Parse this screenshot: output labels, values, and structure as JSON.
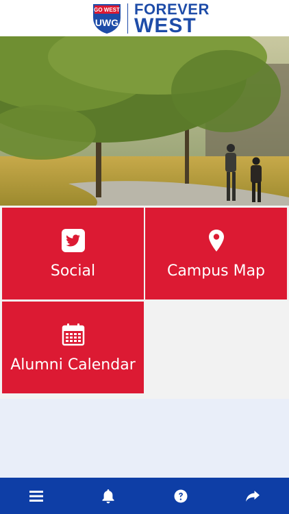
{
  "header": {
    "shield_top": "GO WEST",
    "shield_main": "UWG",
    "wordmark_line1": "FOREVER",
    "wordmark_line2": "WEST"
  },
  "tiles": [
    {
      "label": "Social",
      "icon": "twitter-icon"
    },
    {
      "label": "Campus Map",
      "icon": "map-pin-icon"
    },
    {
      "label": "Alumni Calendar",
      "icon": "calendar-icon"
    }
  ],
  "bottom_nav": [
    {
      "icon": "menu-icon"
    },
    {
      "icon": "bell-icon"
    },
    {
      "icon": "help-icon"
    },
    {
      "icon": "share-icon"
    }
  ],
  "colors": {
    "header_blue": "#1e4ca8",
    "tile_red": "#dc1a33",
    "nav_blue": "#0e3ea6",
    "page_background": "#e9eef9"
  }
}
